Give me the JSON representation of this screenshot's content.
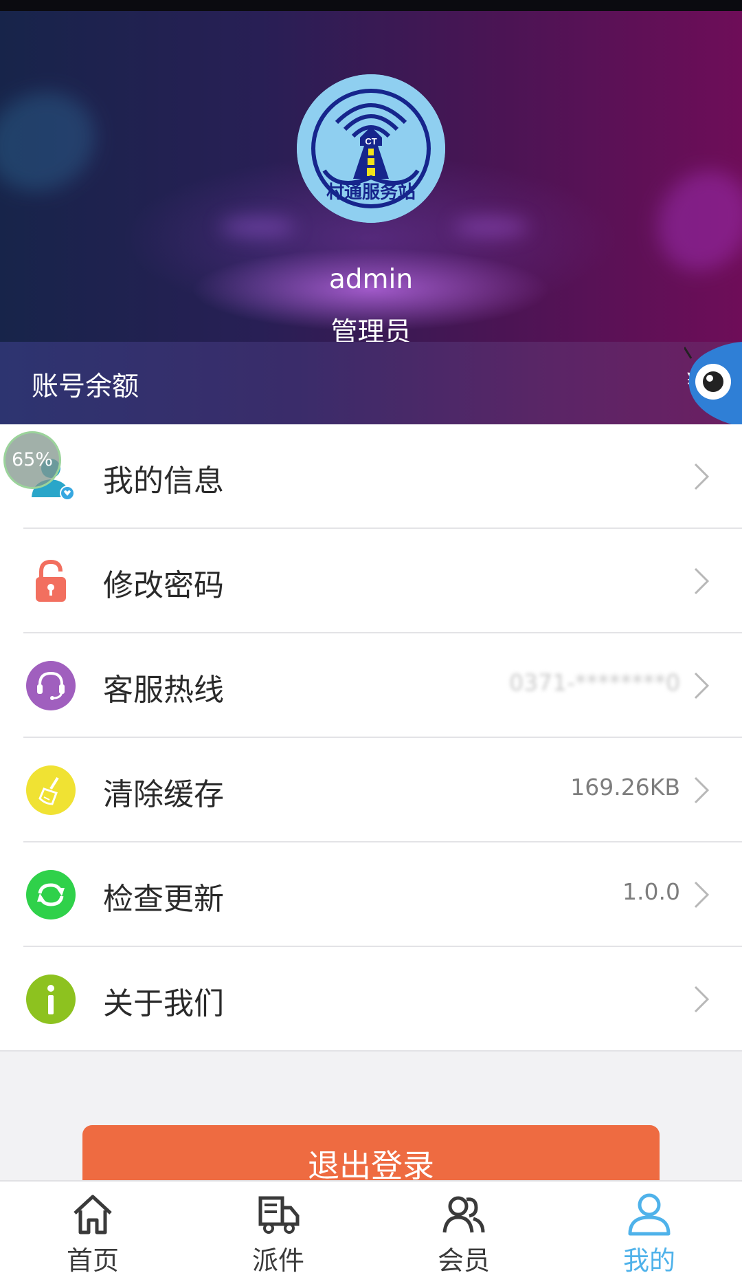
{
  "profile": {
    "avatar_text": "村通服务站",
    "avatar_badge": "CT",
    "username": "admin",
    "role": "管理员"
  },
  "balance": {
    "label": "账号余额",
    "value": "¥"
  },
  "progress_badge": "65%",
  "menu": [
    {
      "label": "我的信息",
      "value": "",
      "icon": "user-info-icon"
    },
    {
      "label": "修改密码",
      "value": "",
      "icon": "lock-icon"
    },
    {
      "label": "客服热线",
      "value": "0371-********0",
      "icon": "headset-icon"
    },
    {
      "label": "清除缓存",
      "value": "169.26KB",
      "icon": "broom-icon"
    },
    {
      "label": "检查更新",
      "value": "1.0.0",
      "icon": "refresh-icon"
    },
    {
      "label": "关于我们",
      "value": "",
      "icon": "info-icon"
    }
  ],
  "logout_label": "退出登录",
  "nav": [
    {
      "label": "首页",
      "icon": "home-icon"
    },
    {
      "label": "派件",
      "icon": "delivery-truck-icon"
    },
    {
      "label": "会员",
      "icon": "members-icon"
    },
    {
      "label": "我的",
      "icon": "profile-icon",
      "active": true
    }
  ],
  "colors": {
    "accent": "#4fb2ea",
    "logout": "#ee6b41",
    "lock": "#f26f5f",
    "headset": "#a05fbe",
    "broom": "#f0e233",
    "refresh": "#2fd14a",
    "info": "#8dc21f"
  }
}
